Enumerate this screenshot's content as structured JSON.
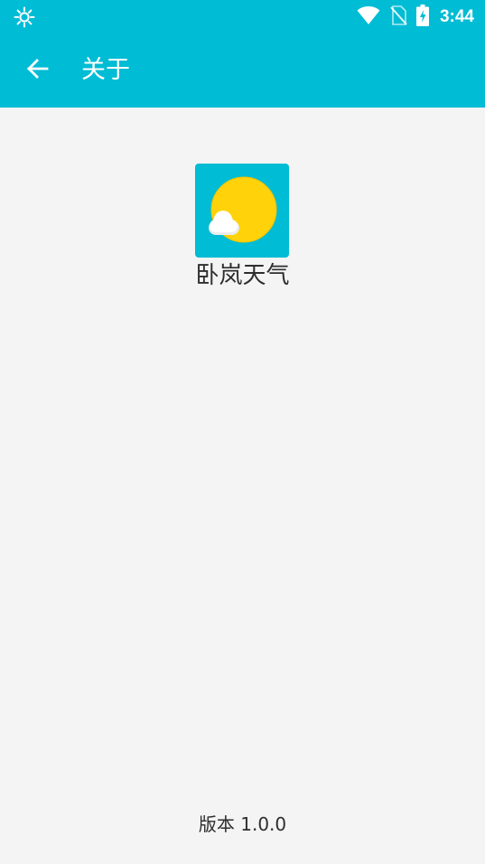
{
  "status_bar": {
    "time": "3:44",
    "left_icon": "brightness-icon",
    "icons": [
      "wifi-icon",
      "no-sim-icon",
      "battery-charging-icon"
    ]
  },
  "app_bar": {
    "title": "关于",
    "back_icon": "arrow-back-icon"
  },
  "app_info": {
    "icon": "weather-sun-cloud-icon",
    "name": "卧岚天气"
  },
  "footer": {
    "version_label": "版本",
    "version_number": "1.0.0"
  },
  "colors": {
    "primary": "#00bcd4",
    "background": "#f4f4f4",
    "sun": "#ffd20a",
    "text": "#2e2e2e"
  }
}
